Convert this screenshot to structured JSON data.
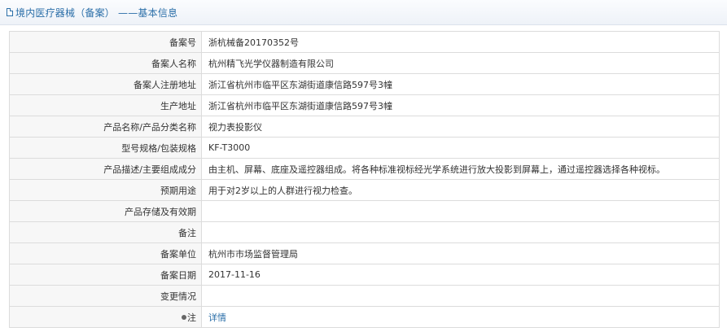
{
  "header": {
    "title": "境内医疗器械（备案） ——基本信息",
    "icon": "document-icon"
  },
  "fields": {
    "record_no": {
      "label": "备案号",
      "value": "浙杭械备20170352号"
    },
    "filer_name": {
      "label": "备案人名称",
      "value": "杭州精飞光学仪器制造有限公司"
    },
    "filer_address": {
      "label": "备案人注册地址",
      "value": "浙江省杭州市临平区东湖街道康信路597号3幢"
    },
    "production_address": {
      "label": "生产地址",
      "value": "浙江省杭州市临平区东湖街道康信路597号3幢"
    },
    "product_name": {
      "label": "产品名称/产品分类名称",
      "value": "视力表投影仪"
    },
    "model_spec": {
      "label": "型号规格/包装规格",
      "value": "KF-T3000"
    },
    "description": {
      "label": "产品描述/主要组成成分",
      "value": "由主机、屏幕、底座及遥控器组成。将各种标准视标经光学系统进行放大投影到屏幕上，通过遥控器选择各种视标。"
    },
    "intended_use": {
      "label": "预期用途",
      "value": "用于对2岁以上的人群进行视力检查。"
    },
    "storage_validity": {
      "label": "产品存储及有效期",
      "value": ""
    },
    "remarks": {
      "label": "备注",
      "value": ""
    },
    "record_unit": {
      "label": "备案单位",
      "value": "杭州市市场监督管理局"
    },
    "record_date": {
      "label": "备案日期",
      "value": "2017-11-16"
    },
    "change_status": {
      "label": "变更情况",
      "value": ""
    },
    "note": {
      "label": "注",
      "link_text": "详情",
      "icon": "bullet-icon"
    }
  }
}
